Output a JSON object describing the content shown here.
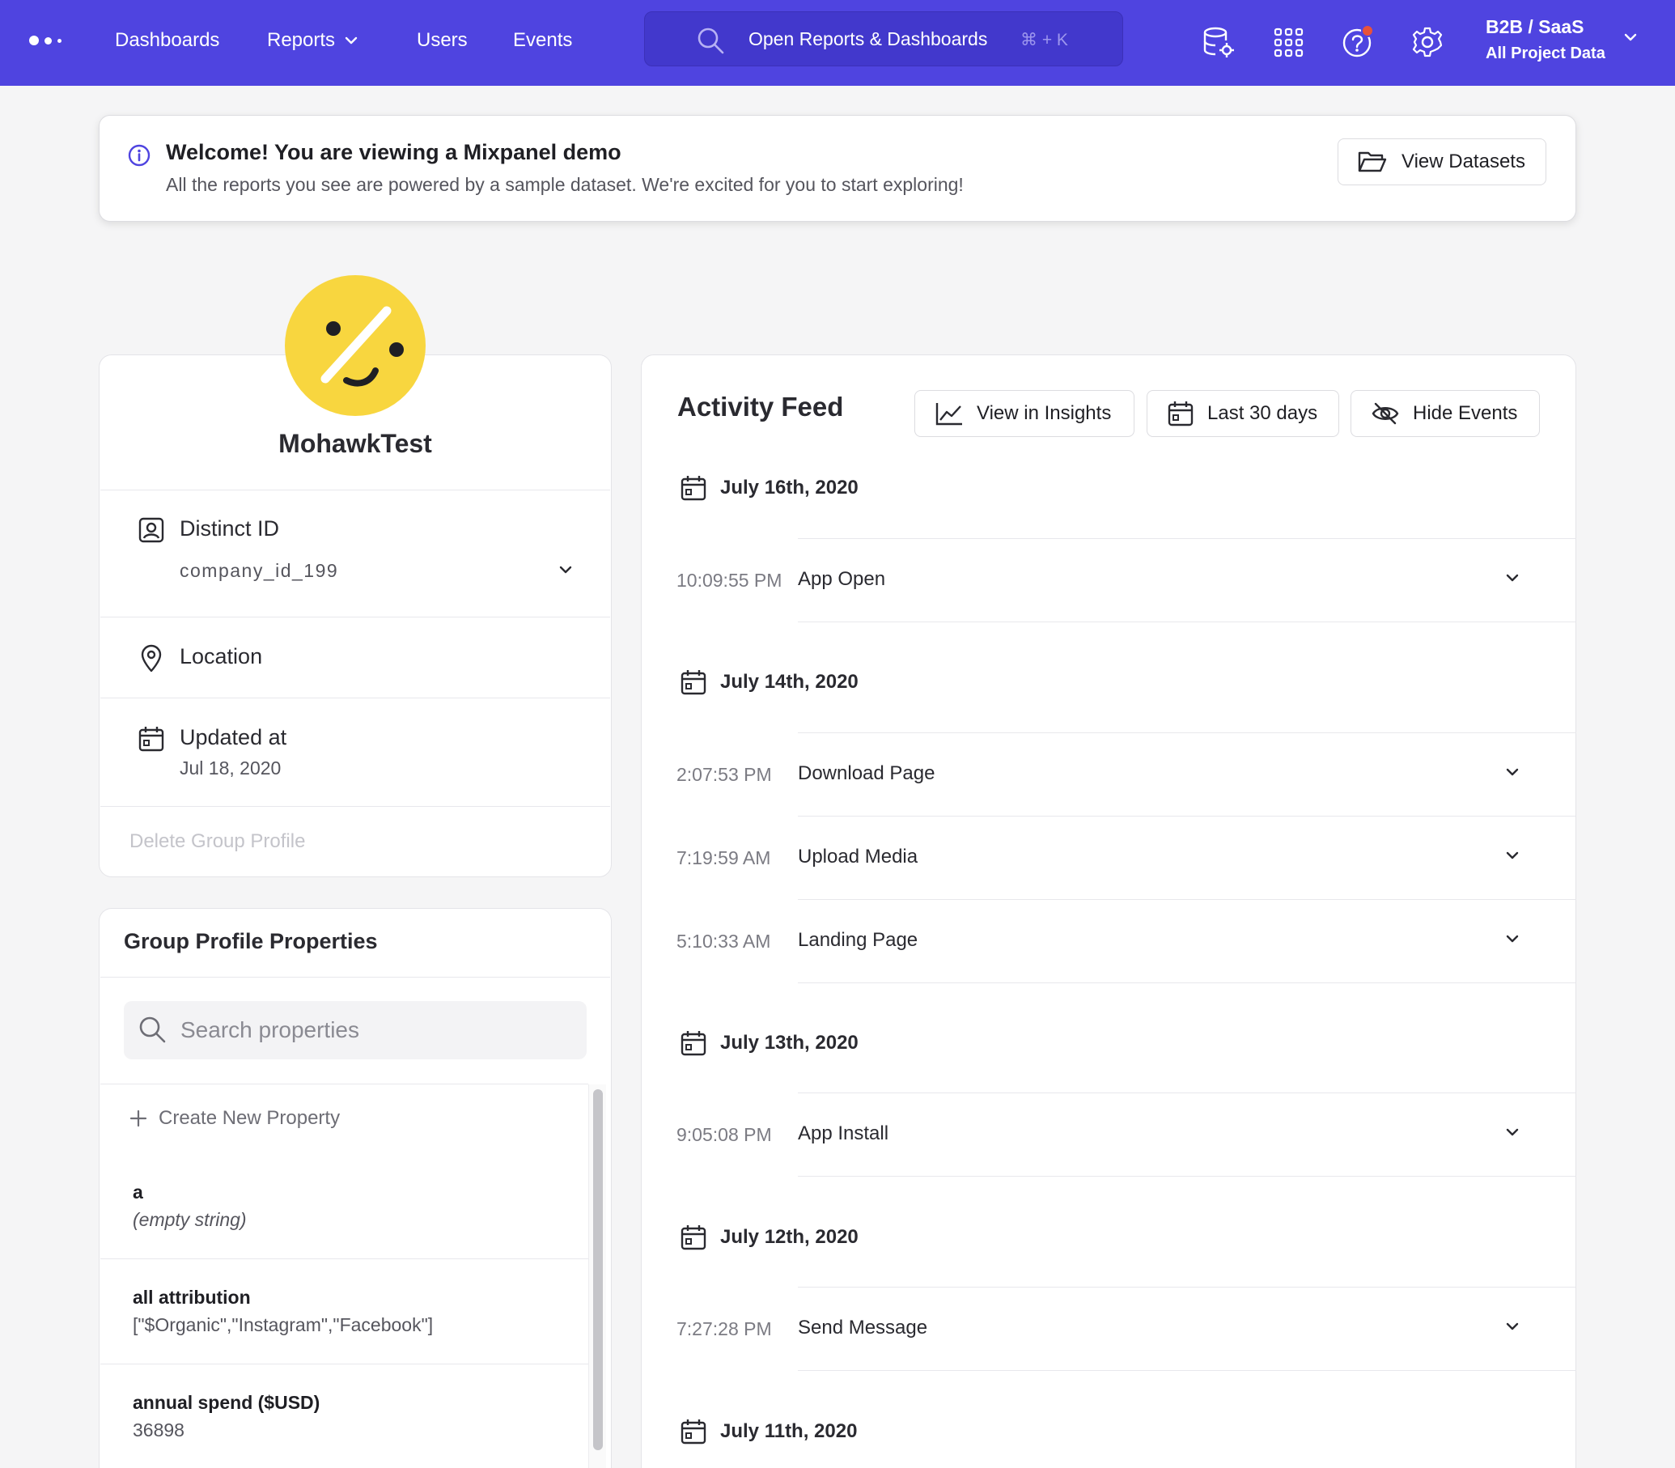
{
  "nav": {
    "items": [
      "Dashboards",
      "Reports",
      "Users",
      "Events"
    ],
    "search_text": "Open Reports & Dashboards",
    "search_shortcut": "⌘ + K",
    "project_name": "B2B / SaaS",
    "project_scope": "All Project Data",
    "brand_color": "#4f44e0"
  },
  "banner": {
    "title": "Welcome! You are viewing a Mixpanel demo",
    "subtitle": "All the reports you see are powered by a sample dataset. We're excited for you to start exploring!",
    "button_label": "View Datasets"
  },
  "profile": {
    "name": "MohawkTest",
    "distinct_id_label": "Distinct ID",
    "distinct_id_value": "company_id_199",
    "location_label": "Location",
    "updated_label": "Updated at",
    "updated_value": "Jul 18, 2020",
    "delete_label": "Delete Group Profile",
    "avatar_color": "#f8d63f"
  },
  "properties": {
    "title": "Group Profile Properties",
    "search_placeholder": "Search properties",
    "create_label": "Create New Property",
    "items": [
      {
        "name": "a",
        "value": "(empty string)"
      },
      {
        "name": "all attribution",
        "value": "[\"$Organic\",\"Instagram\",\"Facebook\"]"
      },
      {
        "name": "annual spend ($USD)",
        "value": "36898"
      }
    ]
  },
  "feed": {
    "title": "Activity Feed",
    "buttons": [
      "View in Insights",
      "Last 30 days",
      "Hide Events"
    ],
    "days": [
      {
        "date": "July 16th, 2020",
        "events": [
          {
            "time": "10:09:55 PM",
            "name": "App Open"
          }
        ]
      },
      {
        "date": "July 14th, 2020",
        "events": [
          {
            "time": "2:07:53 PM",
            "name": "Download Page"
          },
          {
            "time": "7:19:59 AM",
            "name": "Upload Media"
          },
          {
            "time": "5:10:33 AM",
            "name": "Landing Page"
          }
        ]
      },
      {
        "date": "July 13th, 2020",
        "events": [
          {
            "time": "9:05:08 PM",
            "name": "App Install"
          }
        ]
      },
      {
        "date": "July 12th, 2020",
        "events": [
          {
            "time": "7:27:28 PM",
            "name": "Send Message"
          }
        ]
      },
      {
        "date": "July 11th, 2020",
        "events": []
      }
    ]
  }
}
